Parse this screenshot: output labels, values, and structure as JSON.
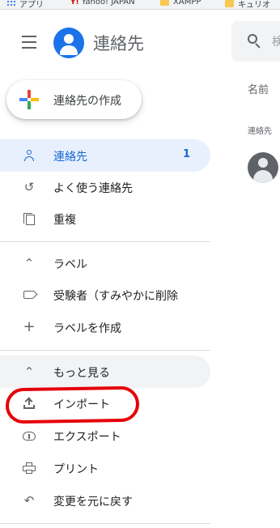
{
  "bookmarks": [
    {
      "label": "アプリ",
      "icon": "apps-grid-icon"
    },
    {
      "label": "Yahoo! JAPAN",
      "icon": "yahoo-logo-icon"
    },
    {
      "label": "XAMPP",
      "icon": "folder-icon"
    },
    {
      "label": "キュリオ",
      "icon": "folder-icon"
    }
  ],
  "header": {
    "title": "連絡先",
    "search_placeholder": "検"
  },
  "create_button": {
    "label": "連絡先の作成"
  },
  "nav": {
    "contacts": {
      "label": "連絡先",
      "count": "1"
    },
    "frequent": {
      "label": "よく使う連絡先"
    },
    "duplicates": {
      "label": "重複"
    },
    "labels_header": {
      "label": "ラベル"
    },
    "label_item": {
      "label": "受験者（すみやかに削除"
    },
    "create_label": {
      "label": "ラベルを作成"
    },
    "more": {
      "label": "もっと見る"
    },
    "import": {
      "label": "インポート"
    },
    "export": {
      "label": "エクスポート"
    },
    "print": {
      "label": "プリント"
    },
    "undo": {
      "label": "変更を元に戻す"
    }
  },
  "main": {
    "column_name": "名前",
    "section_header": "連絡先"
  },
  "colors": {
    "accent": "#1a73e8",
    "active_bg": "#e8f0fe",
    "annotation": "#e5000a"
  }
}
